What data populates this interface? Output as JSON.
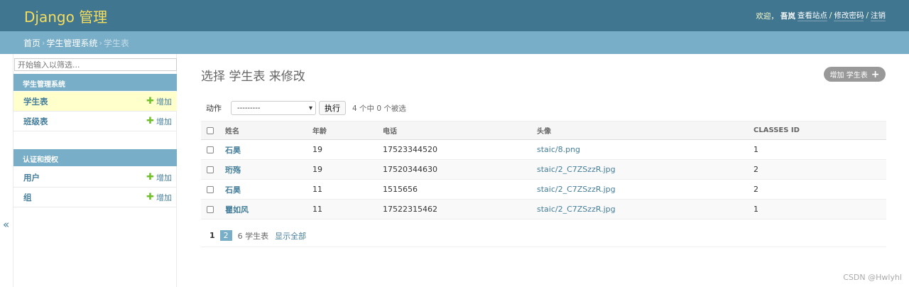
{
  "header": {
    "brand": "Django 管理",
    "welcome": "欢迎，",
    "username": "吾岚",
    "view_site": "查看站点",
    "change_password": "修改密码",
    "logout": "注销",
    "separator": "/"
  },
  "breadcrumbs": {
    "home": "首页",
    "app": "学生管理系统",
    "current": "学生表",
    "sep": "›"
  },
  "sidebar": {
    "filter_placeholder": "开始输入以筛选...",
    "modules": [
      {
        "caption": "学生管理系统",
        "items": [
          {
            "label": "学生表",
            "add": "增加",
            "active": true
          },
          {
            "label": "班级表",
            "add": "增加",
            "active": false
          }
        ]
      },
      {
        "caption": "认证和授权",
        "items": [
          {
            "label": "用户",
            "add": "增加",
            "active": false
          },
          {
            "label": "组",
            "add": "增加",
            "active": false
          }
        ]
      }
    ],
    "collapse_glyph": "«"
  },
  "content": {
    "title": "选择 学生表 来修改",
    "add_button": "增加 学生表",
    "actions": {
      "label": "动作",
      "select_value": "---------",
      "run": "执行",
      "counter": "4 个中 0 个被选"
    },
    "table": {
      "headers": [
        "姓名",
        "年龄",
        "电话",
        "头像",
        "CLASSES ID"
      ],
      "rows": [
        {
          "name": "石昊",
          "age": "19",
          "phone": "17523344520",
          "avatar": "staic/8.png",
          "class_id": "1"
        },
        {
          "name": "珩殇",
          "age": "19",
          "phone": "17520344630",
          "avatar": "staic/2_C7ZSzzR.jpg",
          "class_id": "2"
        },
        {
          "name": "石昊",
          "age": "11",
          "phone": "1515656",
          "avatar": "staic/2_C7ZSzzR.jpg",
          "class_id": "2"
        },
        {
          "name": "瞿如风",
          "age": "11",
          "phone": "17522315462",
          "avatar": "staic/2_C7ZSzzR.jpg",
          "class_id": "1"
        }
      ]
    },
    "paginator": {
      "current_page": "1",
      "other_page": "2",
      "total": "6 学生表",
      "show_all": "显示全部"
    }
  },
  "watermark": "CSDN @Hwlyhl",
  "colors": {
    "header_bg": "#417690",
    "brand": "#f5dd5d",
    "breadcrumb_bg": "#79aec8",
    "link": "#447e9b",
    "active_row": "#ffffcc",
    "add_plus": "#70bf2b"
  }
}
